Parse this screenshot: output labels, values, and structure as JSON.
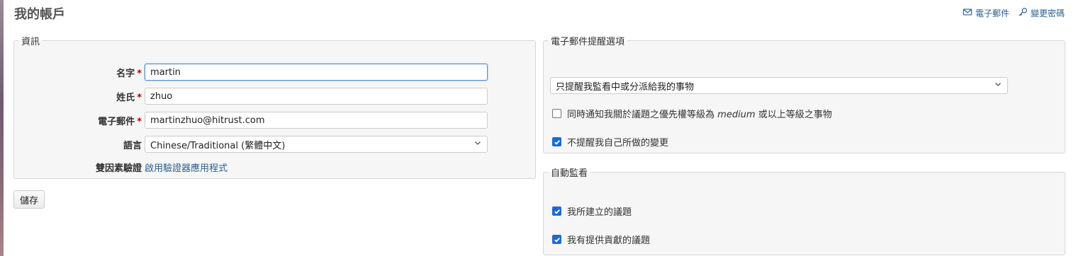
{
  "page": {
    "title": "我的帳戶"
  },
  "header_links": {
    "email": "電子郵件",
    "change_password": "變更密碼"
  },
  "info_section": {
    "legend": "資訊",
    "fields": {
      "firstname": {
        "label": "名字",
        "required_mark": "*",
        "value": "martin"
      },
      "lastname": {
        "label": "姓氏",
        "required_mark": "*",
        "value": "zhuo"
      },
      "email": {
        "label": "電子郵件",
        "required_mark": "*",
        "value": "martinzhuo@hitrust.com"
      },
      "language": {
        "label": "語言",
        "value": "Chinese/Traditional (繁體中文)"
      },
      "twofa": {
        "label": "雙因素驗證",
        "link": "啟用驗證器應用程式"
      }
    }
  },
  "save_button": "儲存",
  "mail_section": {
    "legend": "電子郵件提醒選項",
    "notification_select": "只提醒我監看中或分派給我的事物",
    "option_priority": {
      "before": "同時通知我關於議題之優先權等級為",
      "priority": "medium",
      "after": "或以上等級之事物",
      "checked": false
    },
    "option_no_self": {
      "label": "不提醒我自己所做的變更",
      "checked": true
    }
  },
  "watch_section": {
    "legend": "自動監看",
    "options": [
      {
        "label": "我所建立的議題",
        "checked": true
      },
      {
        "label": "我有提供貢獻的議題",
        "checked": true
      }
    ]
  },
  "icons": {
    "email": "envelope-icon",
    "password": "key-icon",
    "select_arrow": "chevron-down-icon",
    "checkbox_check": "checkmark-icon"
  },
  "colors": {
    "link": "#2a5f8d",
    "required": "#bb0000",
    "checkbox_checked": "#1b6ad2",
    "fieldset_bg": "#f6f6f6",
    "fieldset_border": "#d7d7d7"
  }
}
